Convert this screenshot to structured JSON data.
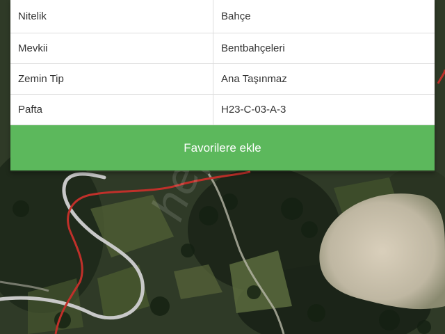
{
  "parcel_info": {
    "rows": [
      {
        "label": "Nitelik",
        "value": "Bahçe"
      },
      {
        "label": "Mevkii",
        "value": "Bentbahçeleri"
      },
      {
        "label": "Zemin Tip",
        "value": "Ana Taşınmaz"
      },
      {
        "label": "Pafta",
        "value": "H23-C-03-A-3"
      }
    ]
  },
  "favorites_button": {
    "label": "Favorilere ekle"
  },
  "watermark": {
    "text": "hepsiemlak"
  },
  "colors": {
    "button_green": "#5cb85c",
    "parcel_border_red": "#c0302a",
    "road_gray": "#bfbfbf"
  }
}
